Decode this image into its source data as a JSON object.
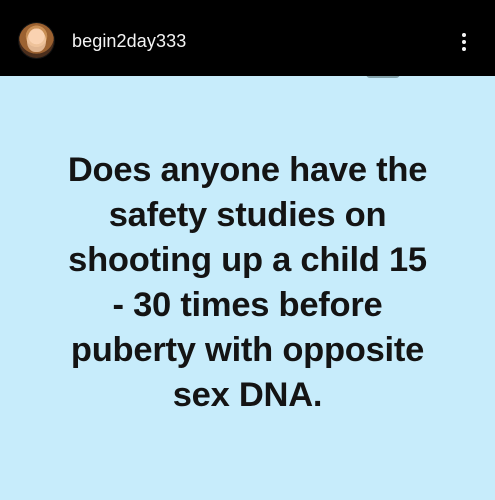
{
  "post": {
    "username": "begin2day333",
    "avatar_icon": "profile-photo-avatar",
    "more_icon": "more-options-icon"
  },
  "image_text": {
    "lines": [
      "Does anyone have the",
      "safety studies on",
      "shooting up a child 15",
      "- 30 times before",
      "puberty with opposite",
      "sex DNA."
    ]
  },
  "colors": {
    "header_background": "#000000",
    "image_background": "#C7ECFB",
    "text": "#141414",
    "username": "#F4F4F4"
  }
}
